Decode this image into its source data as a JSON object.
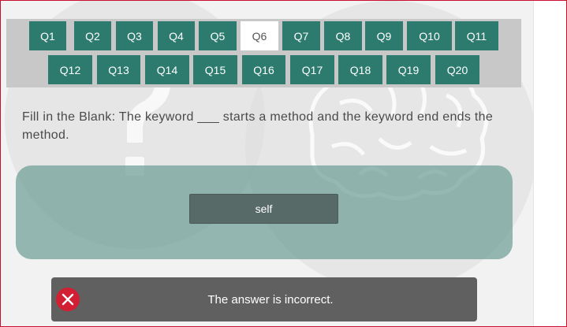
{
  "navigation": {
    "questions": [
      {
        "label": "Q1"
      },
      {
        "label": "Q2"
      },
      {
        "label": "Q3"
      },
      {
        "label": "Q4"
      },
      {
        "label": "Q5"
      },
      {
        "label": "Q6"
      },
      {
        "label": "Q7"
      },
      {
        "label": "Q8"
      },
      {
        "label": "Q9"
      },
      {
        "label": "Q10"
      },
      {
        "label": "Q11"
      },
      {
        "label": "Q12"
      },
      {
        "label": "Q13"
      },
      {
        "label": "Q14"
      },
      {
        "label": "Q15"
      },
      {
        "label": "Q16"
      },
      {
        "label": "Q17"
      },
      {
        "label": "Q18"
      },
      {
        "label": "Q19"
      },
      {
        "label": "Q20"
      }
    ],
    "active": "Q6"
  },
  "question": {
    "text": "Fill in the Blank: The keyword ___ starts a method and the keyword end ends the method."
  },
  "answer": {
    "label": "self"
  },
  "feedback": {
    "message": "The answer is incorrect.",
    "status": "incorrect",
    "icon": "close-icon"
  },
  "colors": {
    "nav_button": "#2d7a6e",
    "nav_active": "#ffffff",
    "answer_panel": "#8fb3ab",
    "answer_button": "#576a67",
    "feedback_bg": "#606060",
    "error": "#d21f33"
  }
}
